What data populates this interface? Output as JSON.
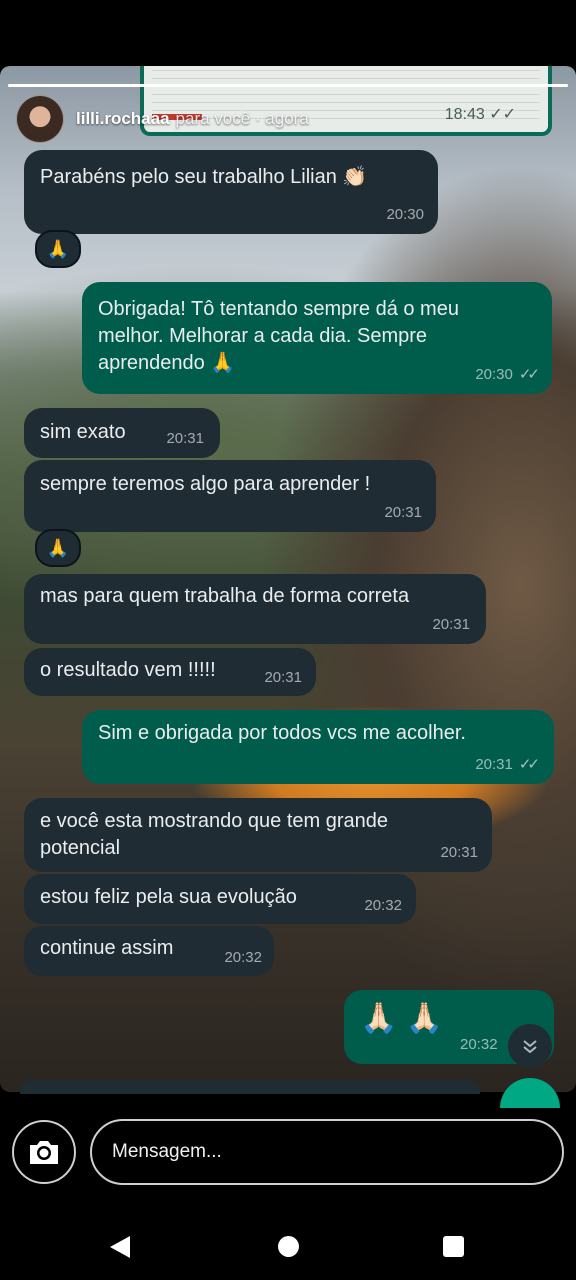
{
  "story": {
    "username": "lilli.rochaaa",
    "subtitle": "para você · agora",
    "embedded_time": "18:43 ✓✓"
  },
  "messages": [
    {
      "id": "m1",
      "dir": "in",
      "text": "Parabéns pelo seu trabalho Lilian 👏🏻",
      "time": "20:30",
      "reaction": "🙏"
    },
    {
      "id": "m2",
      "dir": "out",
      "text": "Obrigada! Tô tentando sempre dá o meu melhor. Melhorar a cada dia. Sempre aprendendo 🙏",
      "time": "20:30"
    },
    {
      "id": "m3",
      "dir": "in",
      "text": "sim exato",
      "time": "20:31"
    },
    {
      "id": "m4",
      "dir": "in",
      "text": "sempre teremos algo para aprender !",
      "time": "20:31",
      "reaction": "🙏"
    },
    {
      "id": "m5",
      "dir": "in",
      "text": "mas para quem trabalha de forma correta",
      "time": "20:31"
    },
    {
      "id": "m6",
      "dir": "in",
      "text": "o resultado vem !!!!!",
      "time": "20:31"
    },
    {
      "id": "m7",
      "dir": "out",
      "text": "Sim e obrigada por todos  vcs me acolher.",
      "time": "20:31"
    },
    {
      "id": "m8",
      "dir": "in",
      "text": "e você esta mostrando que tem grande potencial",
      "time": "20:31"
    },
    {
      "id": "m9",
      "dir": "in",
      "text": "estou feliz pela sua evolução",
      "time": "20:32"
    },
    {
      "id": "m10",
      "dir": "in",
      "text": "continue assim",
      "time": "20:32"
    },
    {
      "id": "m11",
      "dir": "out",
      "text": "🙏🏻 🙏🏻",
      "time": "20:32"
    }
  ],
  "reply": {
    "placeholder": "Mensagem...",
    "camera_icon": "camera-icon"
  },
  "nav": {
    "back": "back-icon",
    "home": "home-icon",
    "recents": "recents-icon"
  }
}
